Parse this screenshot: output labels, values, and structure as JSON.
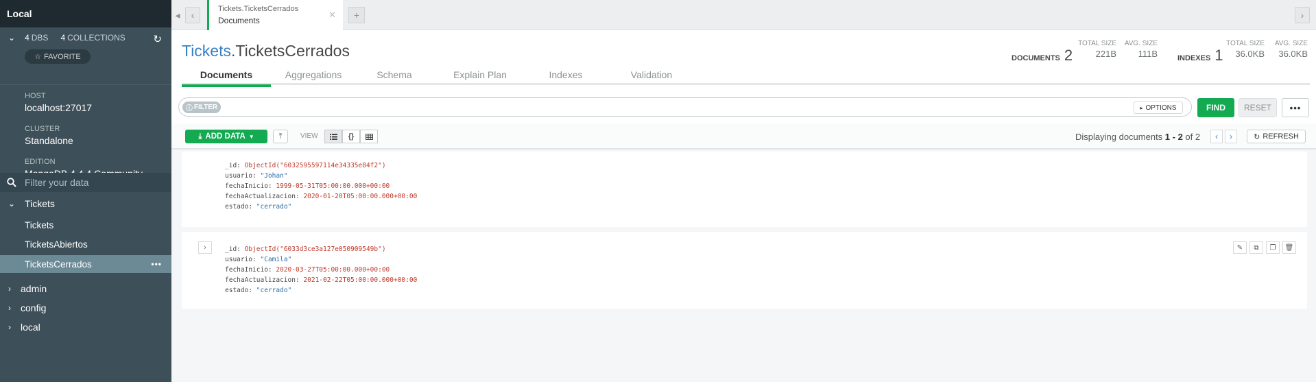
{
  "sidebar": {
    "title": "Local",
    "dbs_count": "4",
    "dbs_label": "DBS",
    "collections_count": "4",
    "collections_label": "COLLECTIONS",
    "favorite_label": "FAVORITE",
    "host_label": "HOST",
    "host_value": "localhost:27017",
    "cluster_label": "CLUSTER",
    "cluster_value": "Standalone",
    "edition_label": "EDITION",
    "edition_value": "MongoDB 4.4.4 Community",
    "filter_placeholder": "Filter your data",
    "databases": [
      {
        "name": "Tickets",
        "expanded": true,
        "collections": [
          "Tickets",
          "TicketsAbiertos",
          "TicketsCerrados"
        ]
      },
      {
        "name": "admin"
      },
      {
        "name": "config"
      },
      {
        "name": "local"
      }
    ]
  },
  "tab": {
    "namespace": "Tickets.TicketsCerrados",
    "subtitle": "Documents"
  },
  "header": {
    "db": "Tickets",
    "collection": ".TicketsCerrados",
    "documents_label": "DOCUMENTS",
    "documents_count": "2",
    "total_size_label": "TOTAL SIZE",
    "total_size_docs": "221B",
    "avg_size_label": "AVG. SIZE",
    "avg_size_docs": "111B",
    "indexes_label": "INDEXES",
    "indexes_count": "1",
    "total_size_idx": "36.0KB",
    "avg_size_idx": "36.0KB",
    "tabs": [
      "Documents",
      "Aggregations",
      "Schema",
      "Explain Plan",
      "Indexes",
      "Validation"
    ]
  },
  "query": {
    "filter_label": "FILTER",
    "options_label": "OPTIONS",
    "find_label": "FIND",
    "reset_label": "RESET"
  },
  "toolbar": {
    "add_data_label": "ADD DATA",
    "view_label": "VIEW",
    "display_prefix": "Displaying documents ",
    "display_range": "1 - 2",
    "display_of": " of 2",
    "refresh_label": "REFRESH"
  },
  "documents": [
    {
      "id": "ObjectId(\"6032595597114e34335e84f2\")",
      "usuario": "\"Johan\"",
      "fechaInicio": "1999-05-31T05:00:00.000+00:00",
      "fechaActualizacion": "2020-01-20T05:00:00.000+00:00",
      "estado": "\"cerrado\""
    },
    {
      "id": "ObjectId(\"6033d3ce3a127e050909549b\")",
      "usuario": "\"Camila\"",
      "fechaInicio": "2020-03-27T05:00:00.000+00:00",
      "fechaActualizacion": "2021-02-22T05:00:00.000+00:00",
      "estado": "\"cerrado\""
    }
  ],
  "field_keys": {
    "id": "_id",
    "usuario": "usuario",
    "fechaInicio": "fechaInicio",
    "fechaActualizacion": "fechaActualizacion",
    "estado": "estado"
  },
  "colors": {
    "brand_green": "#13aa52",
    "sidebar_bg": "#3d4f58",
    "link_blue": "#3a80c5"
  }
}
